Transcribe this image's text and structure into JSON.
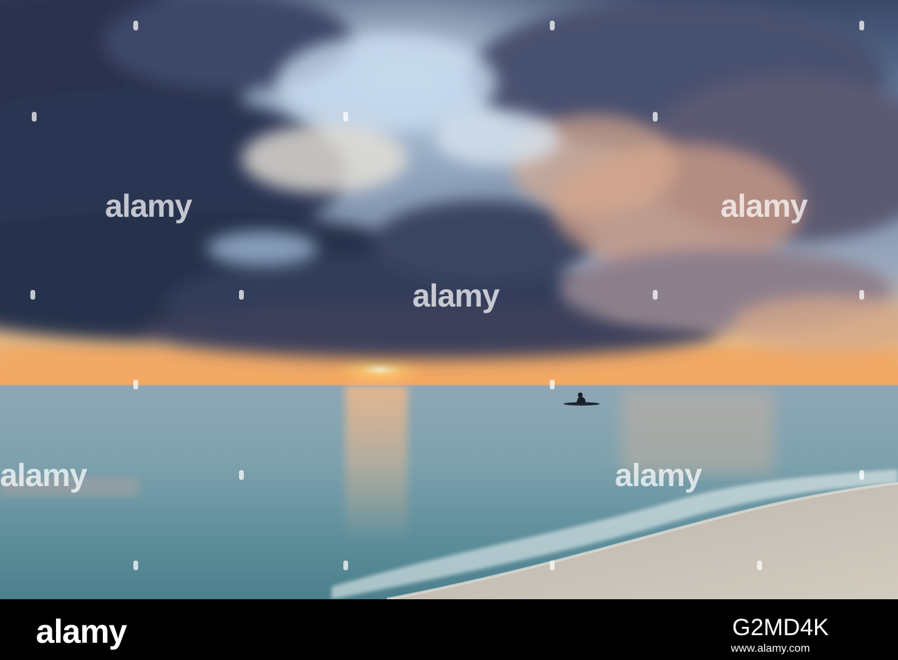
{
  "watermark": {
    "text": "alamy"
  },
  "footer": {
    "logo": "alamy",
    "image_id": "G2MD4K",
    "url": "www.alamy.com"
  },
  "colors": {
    "sky_upper": "#2e3a55",
    "sky_light": "#a9c3df",
    "horizon_glow": "#f6b45c",
    "sea": "#7fa3ad",
    "sand": "#c8c0b4"
  }
}
